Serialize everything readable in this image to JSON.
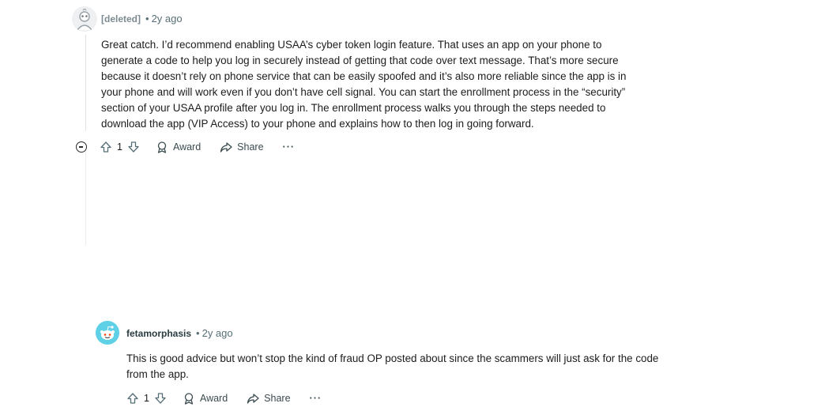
{
  "comments": [
    {
      "author": "[deleted]",
      "time": "2y ago",
      "body": "Great catch. I’d recommend enabling USAA’s cyber token login feature. That uses an app on your phone to generate a code to help you log in securely instead of getting that code over text message. That’s more secure because it doesn’t rely on phone service that can be easily spoofed and it’s also more reliable since the app is in your phone and will work even if you don’t have cell signal. You can start the enrollment process in the “security” section of your USAA profile after you log in. The enrollment process walks you through the steps needed to download the app (VIP Access) to your phone and explains how to then log in going forward.",
      "votes": "1",
      "award_label": "Award",
      "share_label": "Share",
      "more_label": "···"
    },
    {
      "author": "fetamorphasis",
      "time": "2y ago",
      "body": "This is good advice but won’t stop the kind of fraud OP posted about since the scammers will just ask for the code from the app.",
      "votes": "1",
      "award_label": "Award",
      "share_label": "Share",
      "more_label": "···"
    }
  ],
  "separator": "•",
  "colors": {
    "meta": "#576f76",
    "user_avatar": "#5fd1e6",
    "thread_line": "#dfe3e6"
  }
}
